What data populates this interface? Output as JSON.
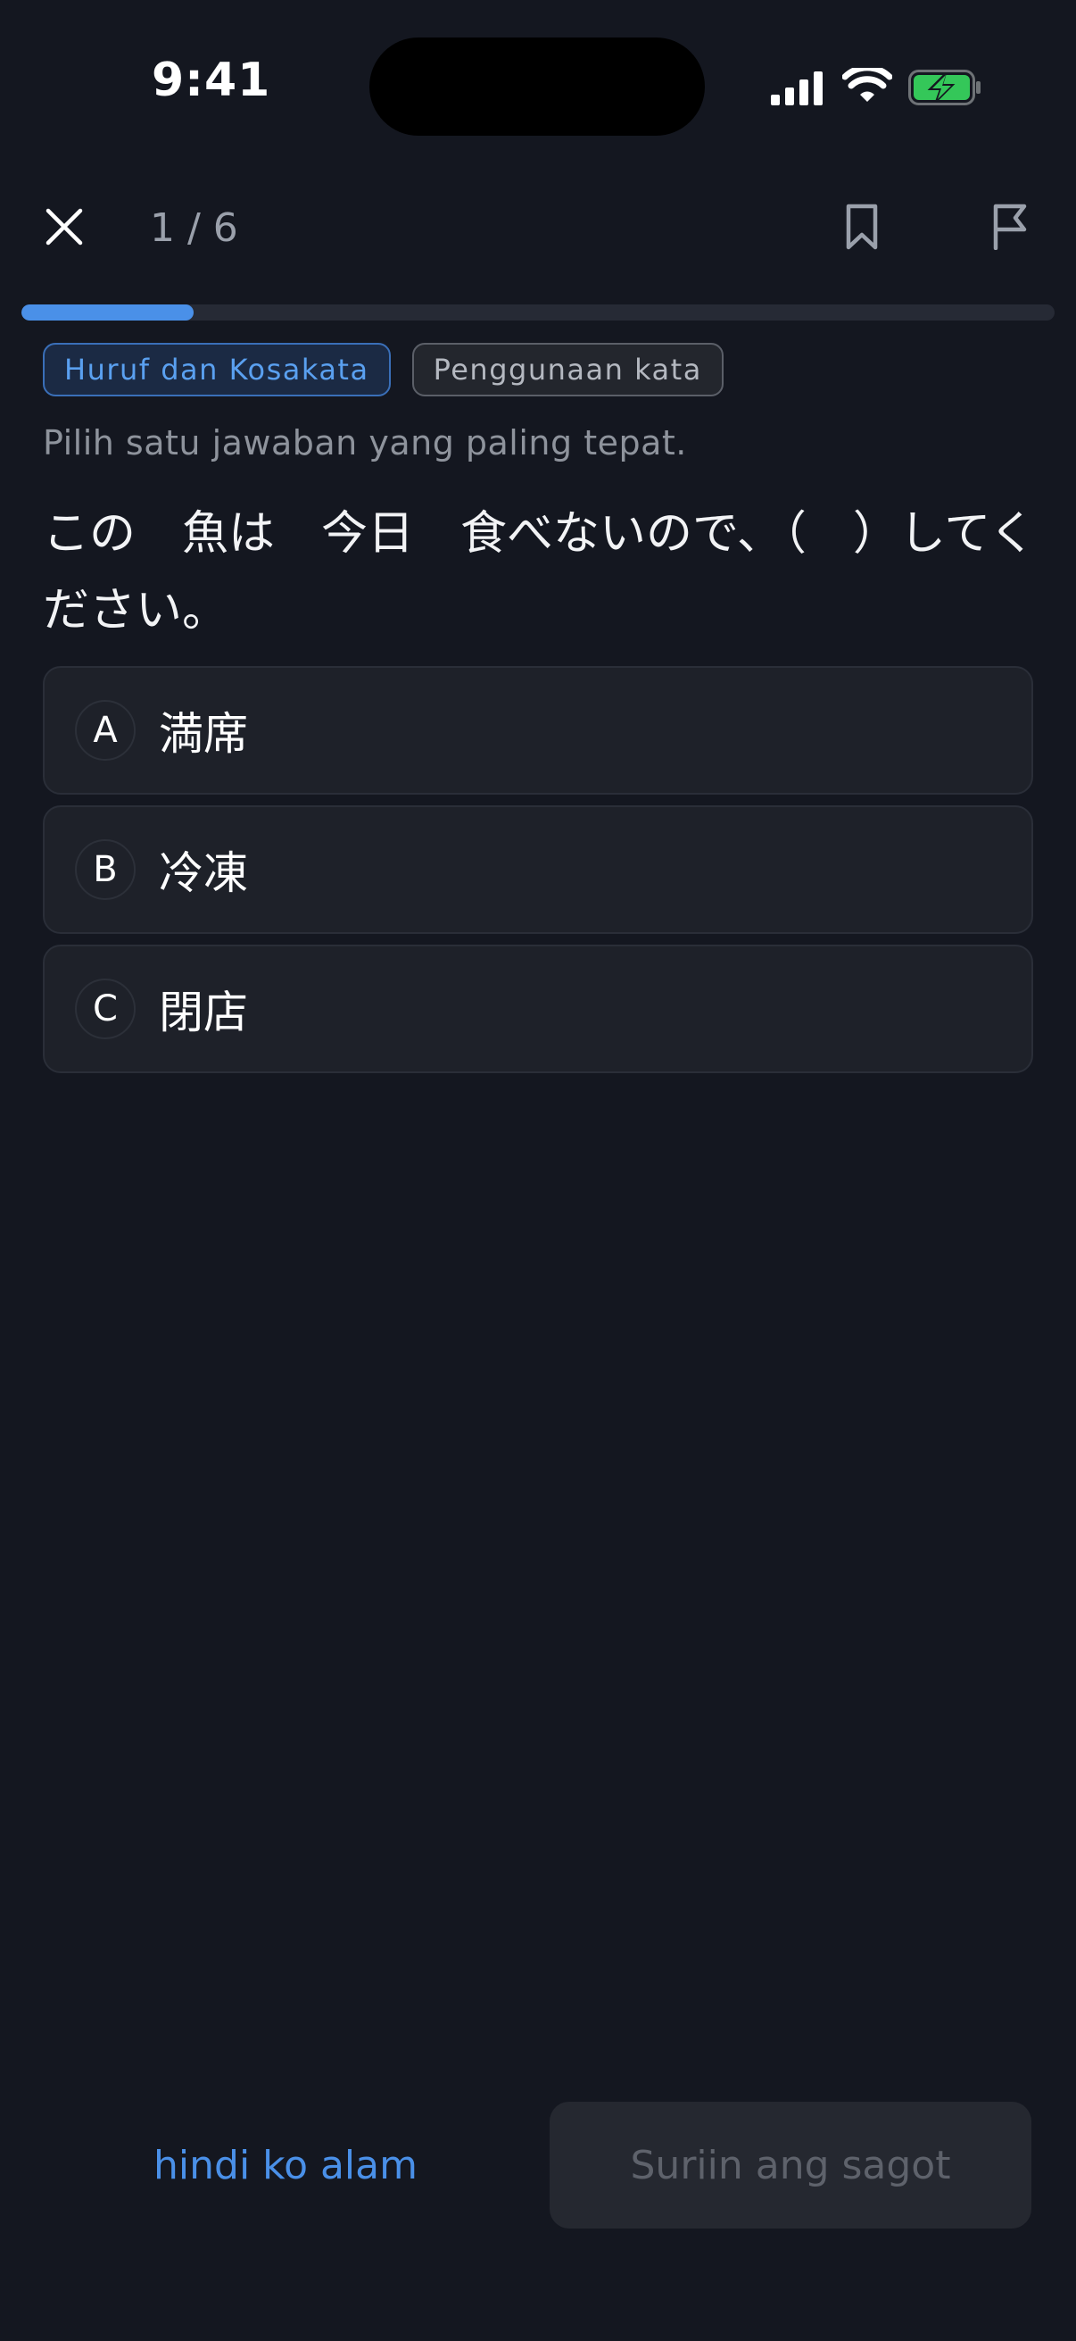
{
  "status_bar": {
    "time": "9:41"
  },
  "header": {
    "counter": "1 / 6",
    "progress_fraction": 0.1667
  },
  "tags": [
    "Huruf dan Kosakata",
    "Penggunaan kata"
  ],
  "instruction": "Pilih satu jawaban yang paling tepat.",
  "question": "この　魚は　今日　食べないので、（　）してください。",
  "options": [
    {
      "letter": "A",
      "text": "満席"
    },
    {
      "letter": "B",
      "text": "冷凍"
    },
    {
      "letter": "C",
      "text": "閉店"
    }
  ],
  "actions": {
    "dont_know": "hindi ko alam",
    "check": "Suriin ang sagot"
  },
  "colors": {
    "background": "#141720",
    "accent": "#4a90e8",
    "battery_green": "#34c759"
  },
  "icons": [
    "close-icon",
    "bookmark-icon",
    "flag-icon",
    "cellular-signal-icon",
    "wifi-icon",
    "battery-charging-icon"
  ]
}
